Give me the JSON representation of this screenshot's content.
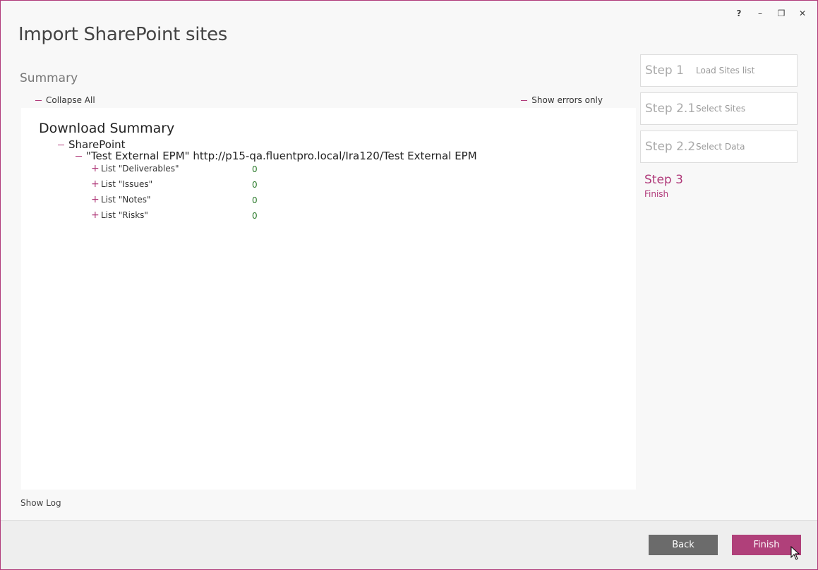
{
  "window": {
    "title": "Import SharePoint sites",
    "controls": {
      "help": "?",
      "minimize": "–",
      "restore": "❐",
      "close": "✕"
    }
  },
  "summary": {
    "label": "Summary",
    "collapse_all": "Collapse All",
    "show_errors_only": "Show errors only",
    "tree": {
      "title": "Download Summary",
      "group": "SharePoint",
      "site": "\"Test External EPM\" http://p15-qa.fluentpro.local/Ira120/Test External EPM",
      "lists": [
        {
          "name": "List \"Deliverables\"",
          "count": "0"
        },
        {
          "name": "List \"Issues\"",
          "count": "0"
        },
        {
          "name": "List \"Notes\"",
          "count": "0"
        },
        {
          "name": "List \"Risks\"",
          "count": "0"
        }
      ]
    },
    "show_log": "Show Log"
  },
  "steps": [
    {
      "num": "Step 1",
      "desc": "Load Sites list",
      "active": false
    },
    {
      "num": "Step 2.1",
      "desc": "Select Sites",
      "active": false
    },
    {
      "num": "Step 2.2",
      "desc": "Select Data",
      "active": false
    },
    {
      "num": "Step 3",
      "desc": "Finish",
      "active": true
    }
  ],
  "footer": {
    "back": "Back",
    "finish": "Finish"
  },
  "colors": {
    "accent": "#b03a7a",
    "count_green": "#2a7a2a",
    "back_button": "#6b6b6b"
  }
}
